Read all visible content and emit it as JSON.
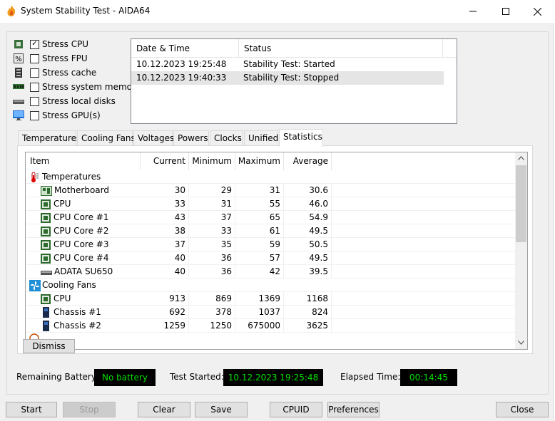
{
  "window": {
    "title": "System Stability Test - AIDA64",
    "minimize_icon": "minimize-icon",
    "maximize_icon": "maximize-icon",
    "close_icon": "close-icon"
  },
  "stress_options": [
    {
      "label": "Stress CPU",
      "checked": true,
      "icon": "cpu-icon"
    },
    {
      "label": "Stress FPU",
      "checked": false,
      "icon": "fpu-icon"
    },
    {
      "label": "Stress cache",
      "checked": false,
      "icon": "cache-icon"
    },
    {
      "label": "Stress system memory",
      "checked": false,
      "icon": "memory-icon"
    },
    {
      "label": "Stress local disks",
      "checked": false,
      "icon": "disk-icon"
    },
    {
      "label": "Stress GPU(s)",
      "checked": false,
      "icon": "gpu-icon"
    }
  ],
  "log": {
    "headers": [
      "Date & Time",
      "Status"
    ],
    "rows": [
      {
        "datetime": "10.12.2023 19:25:48",
        "status": "Stability Test: Started"
      },
      {
        "datetime": "10.12.2023 19:40:33",
        "status": "Stability Test: Stopped"
      }
    ]
  },
  "tabs": [
    "Temperatures",
    "Cooling Fans",
    "Voltages",
    "Powers",
    "Clocks",
    "Unified",
    "Statistics"
  ],
  "active_tab": "Statistics",
  "stats": {
    "headers": [
      "Item",
      "Current",
      "Minimum",
      "Maximum",
      "Average"
    ],
    "rows": [
      {
        "type": "group",
        "label": "Temperatures",
        "icon": "thermometer-icon"
      },
      {
        "type": "item",
        "label": "Motherboard",
        "icon": "motherboard-icon",
        "current": "30",
        "min": "29",
        "max": "31",
        "avg": "30.6"
      },
      {
        "type": "item",
        "label": "CPU",
        "icon": "cpu-chip-icon",
        "current": "33",
        "min": "31",
        "max": "55",
        "avg": "46.0"
      },
      {
        "type": "item",
        "label": "CPU Core #1",
        "icon": "cpu-chip-icon",
        "current": "43",
        "min": "37",
        "max": "65",
        "avg": "54.9"
      },
      {
        "type": "item",
        "label": "CPU Core #2",
        "icon": "cpu-chip-icon",
        "current": "38",
        "min": "33",
        "max": "61",
        "avg": "49.5"
      },
      {
        "type": "item",
        "label": "CPU Core #3",
        "icon": "cpu-chip-icon",
        "current": "37",
        "min": "35",
        "max": "59",
        "avg": "50.5"
      },
      {
        "type": "item",
        "label": "CPU Core #4",
        "icon": "cpu-chip-icon",
        "current": "40",
        "min": "36",
        "max": "57",
        "avg": "49.5"
      },
      {
        "type": "item",
        "label": "ADATA SU650",
        "icon": "drive-icon",
        "current": "40",
        "min": "36",
        "max": "42",
        "avg": "39.5"
      },
      {
        "type": "group",
        "label": "Cooling Fans",
        "icon": "fan-icon"
      },
      {
        "type": "item",
        "label": "CPU",
        "icon": "cpu-chip-icon",
        "current": "913",
        "min": "869",
        "max": "1369",
        "avg": "1168"
      },
      {
        "type": "item",
        "label": "Chassis #1",
        "icon": "chassis-icon",
        "current": "692",
        "min": "378",
        "max": "1037",
        "avg": "824"
      },
      {
        "type": "item",
        "label": "Chassis #2",
        "icon": "chassis-icon",
        "current": "1259",
        "min": "1250",
        "max": "675000",
        "avg": "3625"
      }
    ]
  },
  "dismiss_label": "Dismiss",
  "status_bar": {
    "battery_label": "Remaining Battery:",
    "battery_value": "No battery",
    "started_label": "Test Started:",
    "started_value": "10.12.2023 19:25:48",
    "elapsed_label": "Elapsed Time:",
    "elapsed_value": "00:14:45"
  },
  "buttons": {
    "start": "Start",
    "stop": "Stop",
    "clear": "Clear",
    "save": "Save",
    "cpuid": "CPUID",
    "preferences": "Preferences",
    "close": "Close"
  },
  "colors": {
    "lcd_text": "#00e000",
    "lcd_bg": "#000000",
    "app_icon": "#f29b1d"
  }
}
